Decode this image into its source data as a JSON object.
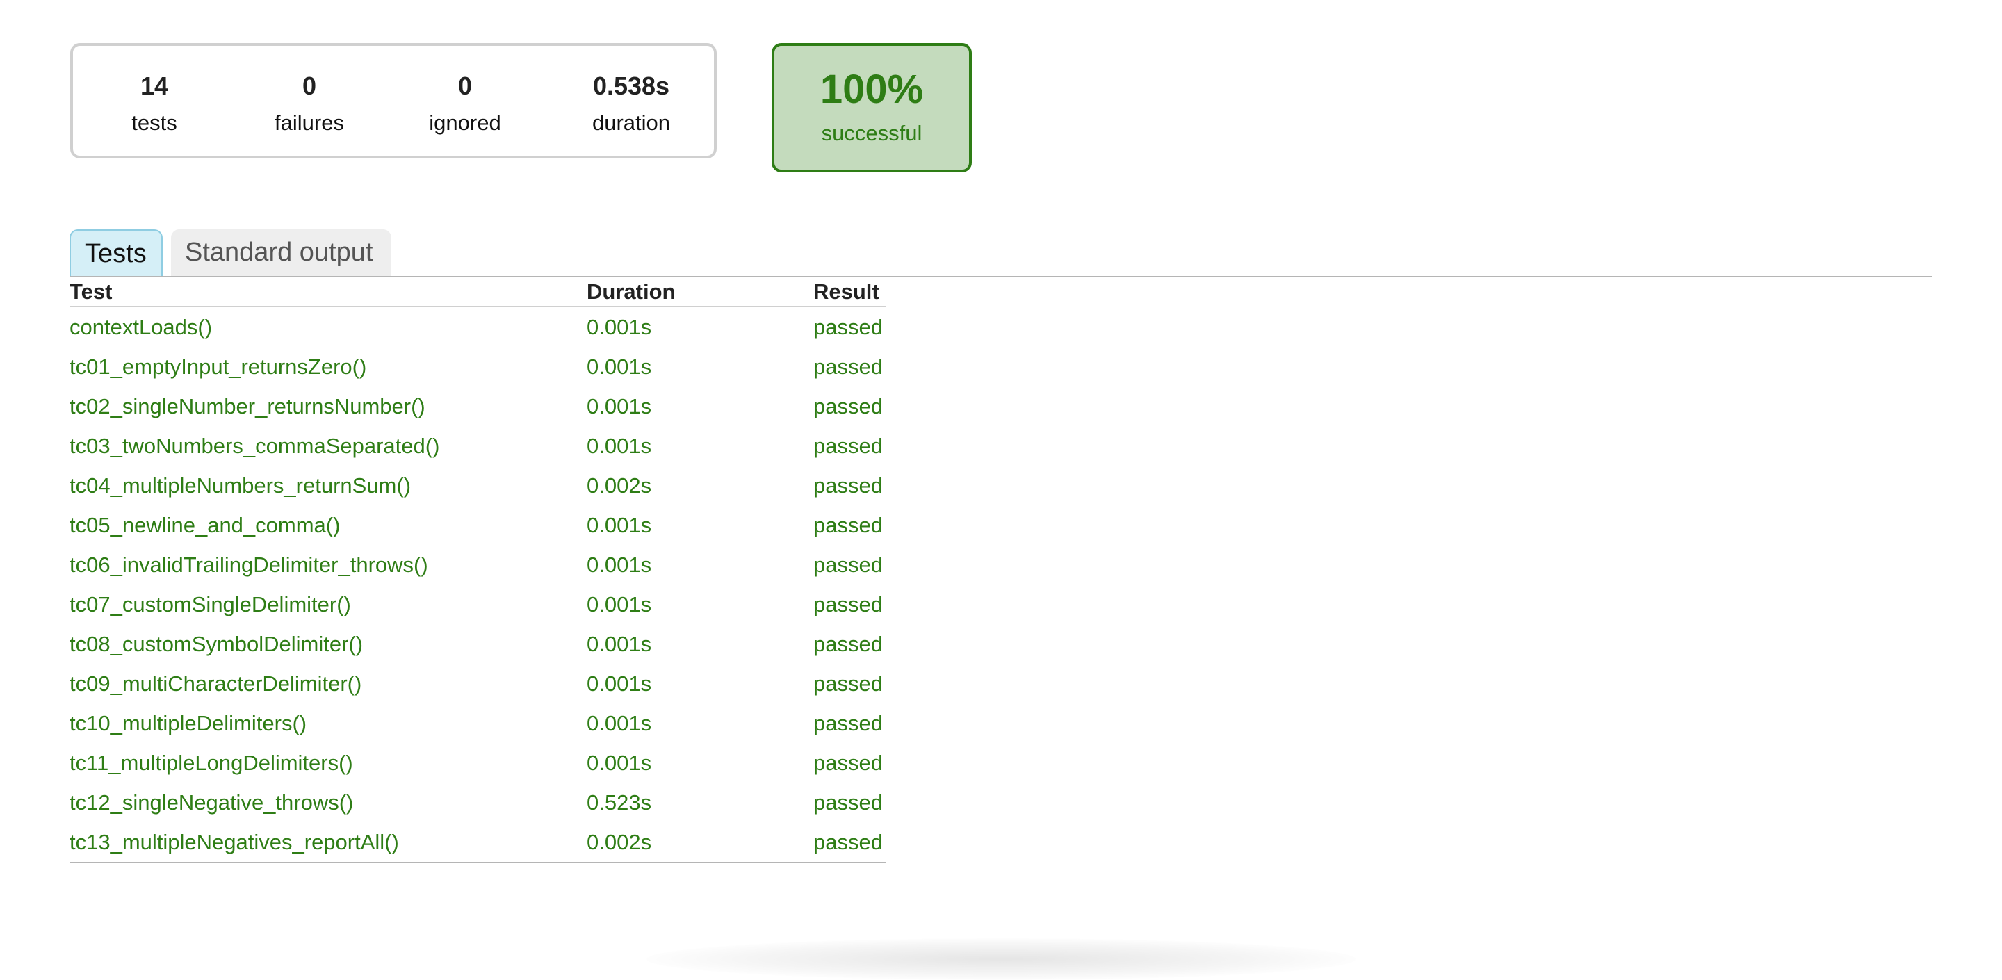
{
  "summary": {
    "counters": [
      {
        "key": "tests",
        "value": "14",
        "label": "tests"
      },
      {
        "key": "failures",
        "value": "0",
        "label": "failures"
      },
      {
        "key": "ignored",
        "value": "0",
        "label": "ignored"
      },
      {
        "key": "duration",
        "value": "0.538s",
        "label": "duration"
      }
    ],
    "success_rate": "100%",
    "success_label": "successful"
  },
  "tabs": [
    {
      "label": "Tests",
      "active": true
    },
    {
      "label": "Standard output",
      "active": false
    }
  ],
  "table": {
    "headers": {
      "test": "Test",
      "duration": "Duration",
      "result": "Result"
    },
    "rows": [
      {
        "test": "contextLoads()",
        "duration": "0.001s",
        "result": "passed"
      },
      {
        "test": "tc01_emptyInput_returnsZero()",
        "duration": "0.001s",
        "result": "passed"
      },
      {
        "test": "tc02_singleNumber_returnsNumber()",
        "duration": "0.001s",
        "result": "passed"
      },
      {
        "test": "tc03_twoNumbers_commaSeparated()",
        "duration": "0.001s",
        "result": "passed"
      },
      {
        "test": "tc04_multipleNumbers_returnSum()",
        "duration": "0.002s",
        "result": "passed"
      },
      {
        "test": "tc05_newline_and_comma()",
        "duration": "0.001s",
        "result": "passed"
      },
      {
        "test": "tc06_invalidTrailingDelimiter_throws()",
        "duration": "0.001s",
        "result": "passed"
      },
      {
        "test": "tc07_customSingleDelimiter()",
        "duration": "0.001s",
        "result": "passed"
      },
      {
        "test": "tc08_customSymbolDelimiter()",
        "duration": "0.001s",
        "result": "passed"
      },
      {
        "test": "tc09_multiCharacterDelimiter()",
        "duration": "0.001s",
        "result": "passed"
      },
      {
        "test": "tc10_multipleDelimiters()",
        "duration": "0.001s",
        "result": "passed"
      },
      {
        "test": "tc11_multipleLongDelimiters()",
        "duration": "0.001s",
        "result": "passed"
      },
      {
        "test": "tc12_singleNegative_throws()",
        "duration": "0.523s",
        "result": "passed"
      },
      {
        "test": "tc13_multipleNegatives_reportAll()",
        "duration": "0.002s",
        "result": "passed"
      }
    ]
  },
  "colors": {
    "success_green": "#2e7d15",
    "success_bg": "#c4dbbd",
    "active_tab_bg": "#d5eff7",
    "inactive_tab_bg": "#eeeeee"
  }
}
